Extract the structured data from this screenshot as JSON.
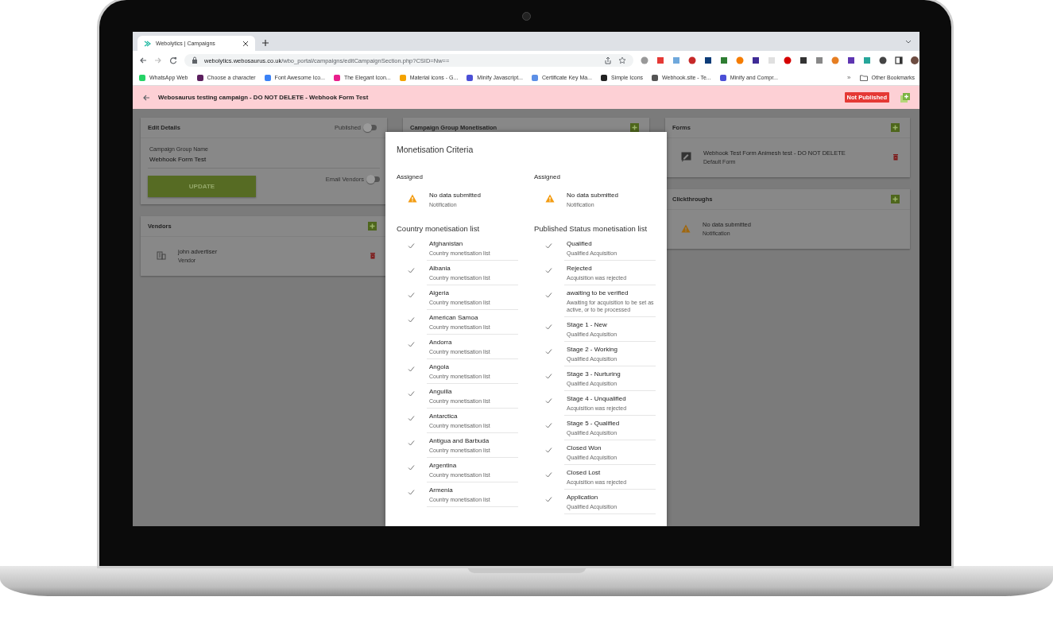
{
  "browser": {
    "tabs": [
      {
        "title": "Webolytics | Campaigns",
        "selected": true
      }
    ],
    "address": {
      "domain": "webolytics.webosaurus.co.uk",
      "path": "/wbo_portal/campaigns/editCampaignSection.php?CSID=Nw=="
    },
    "bookmarks": [
      {
        "label": "WhatsApp Web"
      },
      {
        "label": "Choose a character"
      },
      {
        "label": "Font Awesome Ico..."
      },
      {
        "label": "The Elegant Icon..."
      },
      {
        "label": "Material icons - G..."
      },
      {
        "label": "Minify Javascript..."
      },
      {
        "label": "Certificate Key Ma..."
      },
      {
        "label": "Simple Icons"
      },
      {
        "label": "Webhook.site - Te..."
      },
      {
        "label": "Minify and Compr..."
      }
    ],
    "bookmarks_overflow": "»",
    "other_bookmarks": "Other Bookmarks"
  },
  "header": {
    "title": "Webosaurus testing campaign - DO NOT DELETE - Webhook Form Test",
    "status": "Not Published"
  },
  "edit_details": {
    "title": "Edit Details",
    "published": {
      "label": "Published",
      "on": false
    },
    "field": {
      "label": "Campaign Group Name",
      "value": "Webhook Form Test"
    },
    "button": "UPDATE",
    "email_vendors": {
      "label": "Email Vendors",
      "on": false
    }
  },
  "vendors": {
    "title": "Vendors",
    "items": [
      {
        "name": "john advertiser",
        "subtitle": "Vendor"
      }
    ]
  },
  "campaign_group_monetisation": {
    "title": "Campaign Group Monetisation"
  },
  "forms": {
    "title": "Forms",
    "items": [
      {
        "name": "Webhook Test Form Animesh test - DO NOT DELETE",
        "subtitle": "Default Form"
      }
    ]
  },
  "clickthroughs": {
    "title": "Clickthroughs",
    "items": [
      {
        "name": "No data submitted",
        "subtitle": "Notification"
      }
    ]
  },
  "modal": {
    "title": "Monetisation Criteria",
    "columns": [
      {
        "assigned_heading": "Assigned",
        "assigned": {
          "name": "No data submitted",
          "subtitle": "Notification"
        },
        "list_heading": "Country monetisation list",
        "items": [
          {
            "title": "Afghanistan",
            "subtitle": "Country monetisation list",
            "checked": true
          },
          {
            "title": "Albania",
            "subtitle": "Country monetisation list",
            "checked": true
          },
          {
            "title": "Algeria",
            "subtitle": "Country monetisation list",
            "checked": true
          },
          {
            "title": "American Samoa",
            "subtitle": "Country monetisation list",
            "checked": true
          },
          {
            "title": "Andorra",
            "subtitle": "Country monetisation list",
            "checked": true
          },
          {
            "title": "Angola",
            "subtitle": "Country monetisation list",
            "checked": true
          },
          {
            "title": "Anguilla",
            "subtitle": "Country monetisation list",
            "checked": true
          },
          {
            "title": "Antarctica",
            "subtitle": "Country monetisation list",
            "checked": true
          },
          {
            "title": "Antigua and Barbuda",
            "subtitle": "Country monetisation list",
            "checked": true
          },
          {
            "title": "Argentina",
            "subtitle": "Country monetisation list",
            "checked": true
          },
          {
            "title": "Armenia",
            "subtitle": "Country monetisation list",
            "checked": true
          }
        ]
      },
      {
        "assigned_heading": "Assigned",
        "assigned": {
          "name": "No data submitted",
          "subtitle": "Notification"
        },
        "list_heading": "Published Status monetisation list",
        "items": [
          {
            "title": "Qualified",
            "subtitle": "Qualified Acquisition",
            "checked": true
          },
          {
            "title": "Rejected",
            "subtitle": "Acquisition was rejected",
            "checked": true
          },
          {
            "title": "awaiting to be verified",
            "subtitle": "Awaiting for acquisition to be set as active, or to be processed",
            "checked": true
          },
          {
            "title": "Stage 1 - New",
            "subtitle": "Qualified Acquisition",
            "checked": true
          },
          {
            "title": "Stage 2 - Working",
            "subtitle": "Qualified Acquisition",
            "checked": true
          },
          {
            "title": "Stage 3 - Nurturing",
            "subtitle": "Qualified Acquisition",
            "checked": true
          },
          {
            "title": "Stage 4 - Unqualified",
            "subtitle": "Acquisition was rejected",
            "checked": true
          },
          {
            "title": "Stage 5 - Qualified",
            "subtitle": "Qualified Acquisition",
            "checked": true
          },
          {
            "title": "Closed Won",
            "subtitle": "Qualified Acquisition",
            "checked": true
          },
          {
            "title": "Closed Lost",
            "subtitle": "Acquisition was rejected",
            "checked": true
          },
          {
            "title": "Application",
            "subtitle": "Qualified Acquisition",
            "checked": true
          }
        ]
      }
    ]
  }
}
